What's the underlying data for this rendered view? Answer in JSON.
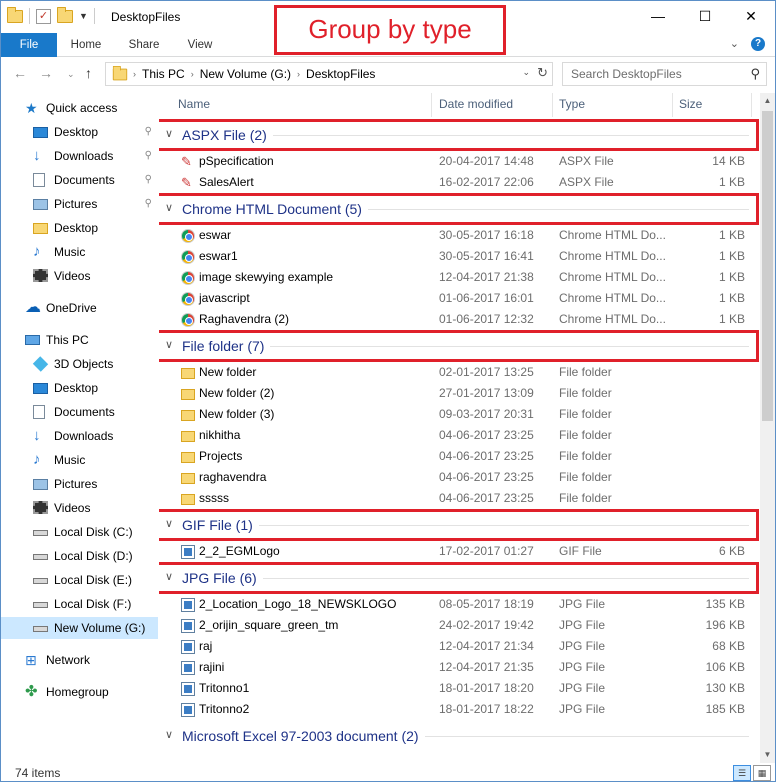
{
  "window": {
    "title": "DesktopFiles",
    "minimize": "—",
    "maximize": "☐",
    "close": "✕"
  },
  "annotation": {
    "title": "Group by type"
  },
  "ribbon": {
    "tabs": [
      "File",
      "Home",
      "Share",
      "View"
    ],
    "expand": "⌄"
  },
  "address": {
    "crumbs": [
      "This PC",
      "New Volume (G:)",
      "DesktopFiles"
    ],
    "search_placeholder": "Search DesktopFiles"
  },
  "nav": [
    {
      "label": "Quick access",
      "icon": "star-icon",
      "indent": 0,
      "pinned": false
    },
    {
      "label": "Desktop",
      "icon": "desktop-icon",
      "indent": 1,
      "pinned": true
    },
    {
      "label": "Downloads",
      "icon": "download-icon",
      "indent": 1,
      "pinned": true
    },
    {
      "label": "Documents",
      "icon": "document-icon",
      "indent": 1,
      "pinned": true
    },
    {
      "label": "Pictures",
      "icon": "pictures-icon",
      "indent": 1,
      "pinned": true
    },
    {
      "label": "Desktop",
      "icon": "folder-icon",
      "indent": 1,
      "pinned": false
    },
    {
      "label": "Music",
      "icon": "music-icon",
      "indent": 1,
      "pinned": false
    },
    {
      "label": "Videos",
      "icon": "videos-icon",
      "indent": 1,
      "pinned": false
    },
    {
      "label": "OneDrive",
      "icon": "onedrive-icon",
      "indent": 0,
      "pinned": false
    },
    {
      "label": "This PC",
      "icon": "this-pc-icon",
      "indent": 0,
      "pinned": false
    },
    {
      "label": "3D Objects",
      "icon": "3d-objects-icon",
      "indent": 1,
      "pinned": false
    },
    {
      "label": "Desktop",
      "icon": "desktop-icon",
      "indent": 1,
      "pinned": false
    },
    {
      "label": "Documents",
      "icon": "document-icon",
      "indent": 1,
      "pinned": false
    },
    {
      "label": "Downloads",
      "icon": "download-icon",
      "indent": 1,
      "pinned": false
    },
    {
      "label": "Music",
      "icon": "music-icon",
      "indent": 1,
      "pinned": false
    },
    {
      "label": "Pictures",
      "icon": "pictures-icon",
      "indent": 1,
      "pinned": false
    },
    {
      "label": "Videos",
      "icon": "videos-icon",
      "indent": 1,
      "pinned": false
    },
    {
      "label": "Local Disk (C:)",
      "icon": "disk-icon",
      "indent": 1,
      "pinned": false
    },
    {
      "label": "Local Disk (D:)",
      "icon": "disk-icon",
      "indent": 1,
      "pinned": false
    },
    {
      "label": "Local Disk (E:)",
      "icon": "disk-icon",
      "indent": 1,
      "pinned": false
    },
    {
      "label": "Local Disk (F:)",
      "icon": "disk-icon",
      "indent": 1,
      "pinned": false
    },
    {
      "label": "New Volume (G:)",
      "icon": "disk-icon",
      "indent": 1,
      "pinned": false,
      "selected": true
    },
    {
      "label": "Network",
      "icon": "network-icon",
      "indent": 0,
      "pinned": false
    },
    {
      "label": "Homegroup",
      "icon": "homegroup-icon",
      "indent": 0,
      "pinned": false
    }
  ],
  "columns": {
    "name": "Name",
    "date": "Date modified",
    "type": "Type",
    "size": "Size"
  },
  "groups": [
    {
      "label": "ASPX File (2)",
      "icon": "aspx-file-icon",
      "highlight": true,
      "files": [
        {
          "name": "pSpecification",
          "date": "20-04-2017 14:48",
          "type": "ASPX File",
          "size": "14 KB"
        },
        {
          "name": "SalesAlert",
          "date": "16-02-2017 22:06",
          "type": "ASPX File",
          "size": "1 KB"
        }
      ]
    },
    {
      "label": "Chrome HTML Document (5)",
      "icon": "chrome-icon",
      "highlight": true,
      "files": [
        {
          "name": "eswar",
          "date": "30-05-2017 16:18",
          "type": "Chrome HTML Do...",
          "size": "1 KB"
        },
        {
          "name": "eswar1",
          "date": "30-05-2017 16:41",
          "type": "Chrome HTML Do...",
          "size": "1 KB"
        },
        {
          "name": "image skewying example",
          "date": "12-04-2017 21:38",
          "type": "Chrome HTML Do...",
          "size": "1 KB"
        },
        {
          "name": "javascript",
          "date": "01-06-2017 16:01",
          "type": "Chrome HTML Do...",
          "size": "1 KB"
        },
        {
          "name": "Raghavendra (2)",
          "date": "01-06-2017 12:32",
          "type": "Chrome HTML Do...",
          "size": "1 KB"
        }
      ]
    },
    {
      "label": "File folder (7)",
      "icon": "folder-icon",
      "highlight": true,
      "files": [
        {
          "name": "New folder",
          "date": "02-01-2017 13:25",
          "type": "File folder",
          "size": ""
        },
        {
          "name": "New folder (2)",
          "date": "27-01-2017 13:09",
          "type": "File folder",
          "size": ""
        },
        {
          "name": "New folder (3)",
          "date": "09-03-2017 20:31",
          "type": "File folder",
          "size": ""
        },
        {
          "name": "nikhitha",
          "date": "04-06-2017 23:25",
          "type": "File folder",
          "size": ""
        },
        {
          "name": "Projects",
          "date": "04-06-2017 23:25",
          "type": "File folder",
          "size": ""
        },
        {
          "name": "raghavendra",
          "date": "04-06-2017 23:25",
          "type": "File folder",
          "size": ""
        },
        {
          "name": "sssss",
          "date": "04-06-2017 23:25",
          "type": "File folder",
          "size": ""
        }
      ]
    },
    {
      "label": "GIF File (1)",
      "icon": "image-file-icon",
      "highlight": true,
      "files": [
        {
          "name": "2_2_EGMLogo",
          "date": "17-02-2017 01:27",
          "type": "GIF File",
          "size": "6 KB"
        }
      ]
    },
    {
      "label": "JPG File (6)",
      "icon": "image-file-icon",
      "highlight": true,
      "files": [
        {
          "name": "2_Location_Logo_18_NEWSKLOGO",
          "date": "08-05-2017 18:19",
          "type": "JPG File",
          "size": "135 KB"
        },
        {
          "name": "2_orijin_square_green_tm",
          "date": "24-02-2017 19:42",
          "type": "JPG File",
          "size": "196 KB"
        },
        {
          "name": "raj",
          "date": "12-04-2017 21:34",
          "type": "JPG File",
          "size": "68 KB"
        },
        {
          "name": "rajini",
          "date": "12-04-2017 21:35",
          "type": "JPG File",
          "size": "106 KB"
        },
        {
          "name": "Tritonno1",
          "date": "18-01-2017 18:20",
          "type": "JPG File",
          "size": "130 KB"
        },
        {
          "name": "Tritonno2",
          "date": "18-01-2017 18:22",
          "type": "JPG File",
          "size": "185 KB"
        }
      ]
    },
    {
      "label": "Microsoft Excel 97-2003 document (2)",
      "icon": "excel-icon",
      "highlight": false,
      "files": []
    }
  ],
  "status": {
    "count": "74 items"
  },
  "colors": {
    "accent": "#1979ca",
    "highlight_border": "#e0202a",
    "group_text": "#1e3287"
  }
}
